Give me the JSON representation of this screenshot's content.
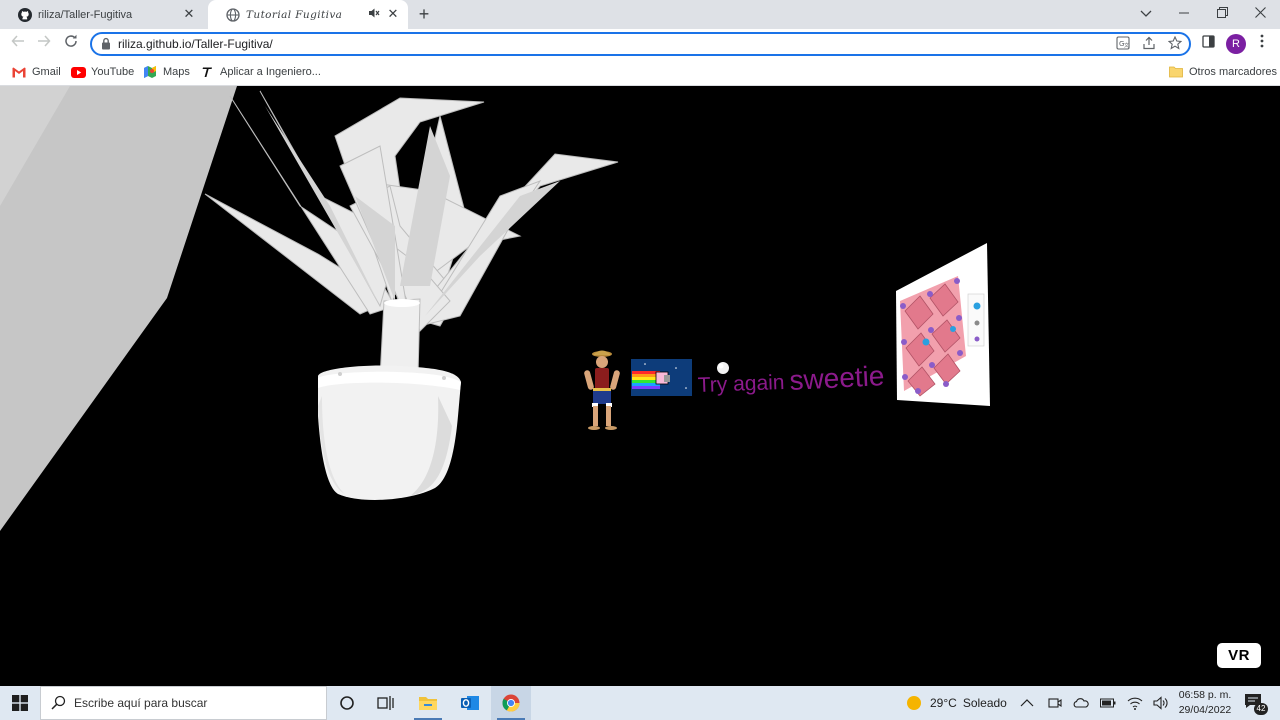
{
  "browser": {
    "tabs": [
      {
        "title": "riliza/Taller-Fugitiva",
        "favicon": "github-icon",
        "active": false
      },
      {
        "title": "Tutorial Fugitiva",
        "favicon": "globe-icon",
        "active": true,
        "muted_icon": "speaker-mute-icon"
      }
    ],
    "new_tab_icon": "plus-icon",
    "window_controls": [
      "chevron-down-icon",
      "minimize-icon",
      "restore-icon",
      "close-icon"
    ],
    "url": "riliza.github.io/Taller-Fugitiva/",
    "profile_initial": "R",
    "profile_color": "#7b1fa2",
    "bookmarks": [
      {
        "label": "Gmail",
        "icon": "gmail-icon"
      },
      {
        "label": "YouTube",
        "icon": "youtube-icon"
      },
      {
        "label": "Maps",
        "icon": "maps-icon"
      },
      {
        "label": "Aplicar a Ingeniero...",
        "icon": "italic-t-icon"
      }
    ],
    "other_bookmarks": "Otros marcadores"
  },
  "scene": {
    "message_small": "Try again",
    "message_big": "sweetie",
    "message_color": "#8b1a8b",
    "vr_button": "VR"
  },
  "taskbar": {
    "search_placeholder": "Escribe aquí para buscar",
    "weather_temp": "29°C",
    "weather_text": "Soleado",
    "time": "06:58 p. m.",
    "date": "29/04/2022",
    "notification_count": "42"
  }
}
